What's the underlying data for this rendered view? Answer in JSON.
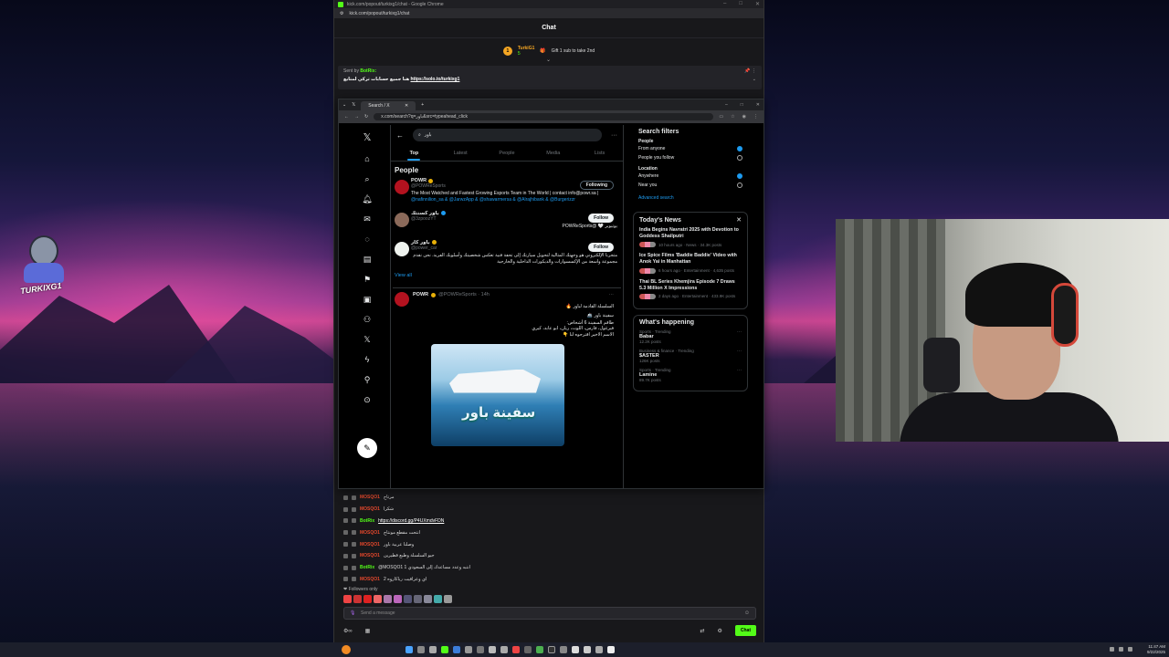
{
  "overlay": {
    "streamer_logo_text": "TURKIXG1"
  },
  "chat_window": {
    "title": "kick.com/popout/turkixg1/chat - Google Chrome",
    "url": "kick.com/popout/turkixg1/chat",
    "header": "Chat",
    "gift": {
      "badge": "1",
      "user": "TurkiG1",
      "sub": "5",
      "text": "Gift 1 sub to take 2nd"
    },
    "pinned": {
      "sent_by": "Sent by",
      "bot": "BotRix:",
      "text": "هنا جميع حسابات تركي لمتابع",
      "link": "https://solo.to/turkixg1"
    },
    "messages": [
      {
        "user": "MOSQO1",
        "text": "مرتاح",
        "bot": false
      },
      {
        "user": "MOSQO1",
        "text": "شكرا",
        "bot": false
      },
      {
        "user": "BotRix",
        "text": "https://discord.gg/P4UXmdvFDN",
        "bot": true,
        "link": true
      },
      {
        "user": "MOSQO1",
        "text": "انتحت مقطع مونتاج",
        "bot": false
      },
      {
        "user": "MOSQO1",
        "text": "وصلنا عربية باور",
        "bot": false
      },
      {
        "user": "MOSQO1",
        "text": "جيو السلسلة وطبع قطيرين",
        "bot": false
      },
      {
        "user": "BotRix",
        "text": "@MOSQO1 انتبه وعدد مساعدك إلى السعودي 1",
        "bot": true,
        "link": false
      },
      {
        "user": "MOSQO1",
        "text": "اي وعراقيت رباكاروه 2",
        "bot": false
      }
    ],
    "followers_only": "Followers only",
    "send_placeholder": "Send a message",
    "chat_button": "Chat"
  },
  "x_window": {
    "tab_title": "Search / X",
    "url": "x.com/search?q=باور&src=typeahead_click",
    "search_value": "باور",
    "tabs": [
      "Top",
      "Latest",
      "People",
      "Media",
      "Lists"
    ],
    "people_title": "People",
    "people": [
      {
        "name": "POWR",
        "handle": "@POWReSports",
        "button": "Following",
        "bio": "The Most Watched and Fastest Growing Esports Team in The World | contact info@powr.sa |",
        "links": "@nafinnilion_sa & @JarwzApp & @shawarmersa & @Alrajhibank & @Burgerizzr",
        "verified": "gold",
        "rtl": false
      },
      {
        "name": "باور كسنتك",
        "handle": "@3zpoozYT",
        "button": "Follow",
        "bio": "يوتيوبر 🤍 @POWReSports",
        "links": "",
        "verified": "blue",
        "rtl": true
      },
      {
        "name": "باور كار",
        "handle": "@power_car",
        "button": "Follow",
        "bio": "متجرنا الإلكتروني هو وجهتك المثالية لتحويل سيارتك إلى تحفة فنية تعكس شخصيتك وأسلوبك الفريد. نحن نقدم مجموعة واسعة من الإكسسوارات والديكورات الداخلية والخارجية",
        "links": "",
        "verified": "gold",
        "rtl": true
      }
    ],
    "view_all": "View all",
    "tweet": {
      "name": "POWR",
      "handle": "@POWReSports · 14h",
      "lines": [
        "السلسلة القادمة لباور 🔥",
        "سفينة باور 🚢",
        "طاقم السفينة 6 أشخاص:",
        "فيرغول، فارس، اللوت، ريان، ابو عابد، كيري",
        "الاسم الاخير اقترحوه لنا 👇"
      ],
      "media_text": "سفينة باور"
    },
    "filters": {
      "title": "Search filters",
      "people_label": "People",
      "people_options": [
        {
          "label": "From anyone",
          "on": true
        },
        {
          "label": "People you follow",
          "on": false
        }
      ],
      "location_label": "Location",
      "location_options": [
        {
          "label": "Anywhere",
          "on": true
        },
        {
          "label": "Near you",
          "on": false
        }
      ],
      "advanced": "Advanced search"
    },
    "news": {
      "title": "Today's News",
      "items": [
        {
          "title": "India Begins Navratri 2025 with Devotion to Goddess Shailputri",
          "meta": "10 hours ago · News · 34.3K posts"
        },
        {
          "title": "Ice Spice Films 'Baddie Baddie' Video with Anok Yai in Manhattan",
          "meta": "6 hours ago · Entertainment · 4,635 posts"
        },
        {
          "title": "Thai BL Series Khemjira Episode 7 Draws 5.3 Million X Impressions",
          "meta": "2 days ago · Entertainment · 433.9K posts"
        }
      ]
    },
    "happening": {
      "title": "What's happening",
      "trends": [
        {
          "category": "Sports · Trending",
          "name": "Babar",
          "posts": "12.2K posts"
        },
        {
          "category": "Business & finance · Trending",
          "name": "$ASTER",
          "posts": "126K posts"
        },
        {
          "category": "Sports · Trending",
          "name": "Lamine",
          "posts": "89.7K posts"
        }
      ]
    }
  },
  "taskbar": {
    "time": "11:47 AM",
    "date": "9/22/2025"
  }
}
